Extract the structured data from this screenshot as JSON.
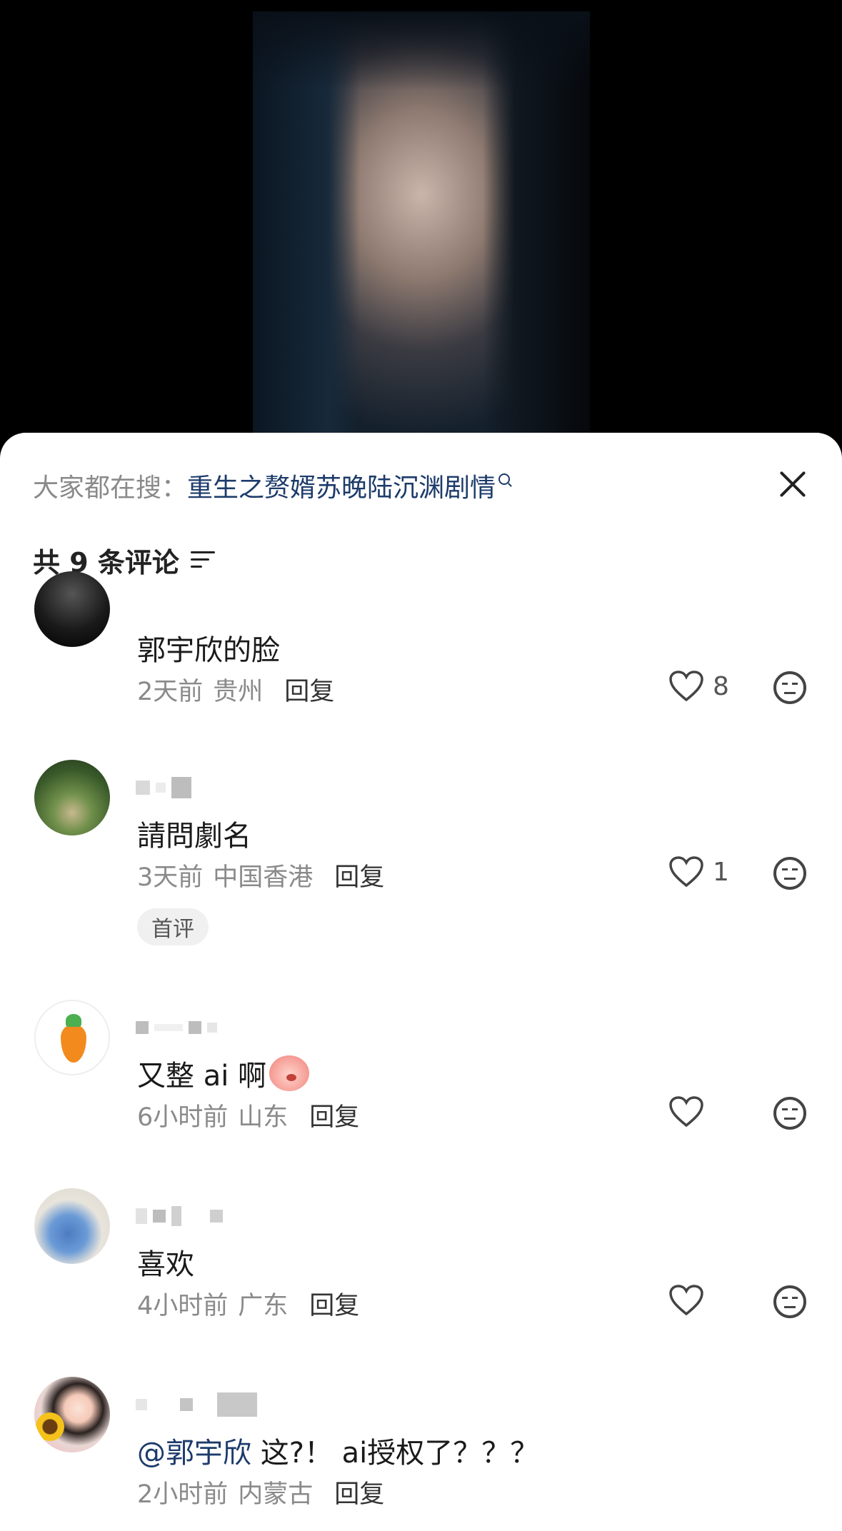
{
  "search": {
    "prefix": "大家都在搜：",
    "term": "重生之赘婿苏晚陆沉渊剧情"
  },
  "header": {
    "count_label": "共 9 条评论"
  },
  "comments": [
    {
      "text": "郭宇欣的脸",
      "time": "2天前",
      "location": "贵州",
      "reply": "回复",
      "likes": "8"
    },
    {
      "text": "請問劇名",
      "time": "3天前",
      "location": "中国香港",
      "reply": "回复",
      "likes": "1",
      "badge": "首评"
    },
    {
      "text": "又整 ai 啊",
      "time": "6小时前",
      "location": "山东",
      "reply": "回复",
      "likes": ""
    },
    {
      "text": "喜欢",
      "time": "4小时前",
      "location": "广东",
      "reply": "回复",
      "likes": ""
    },
    {
      "mention": "@郭宇欣",
      "text": " 这?！ ai授权了？？？",
      "time": "2小时前",
      "location": "内蒙古",
      "reply": "回复"
    }
  ]
}
